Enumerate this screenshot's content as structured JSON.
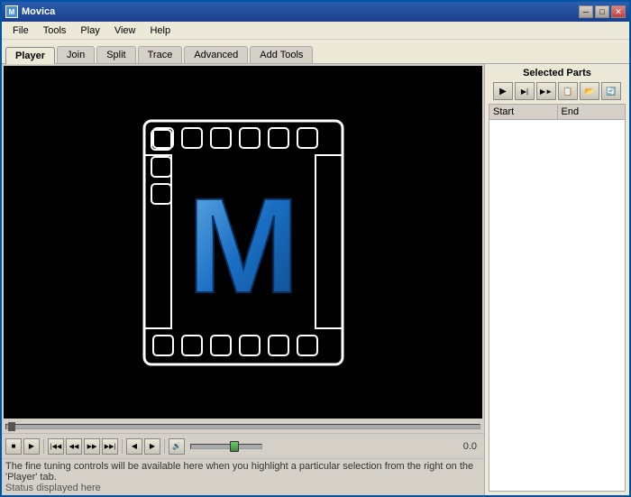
{
  "window": {
    "title": "Movica",
    "icon_label": "M"
  },
  "titlebar_buttons": {
    "minimize": "─",
    "maximize": "□",
    "close": "✕"
  },
  "menubar": {
    "items": [
      "File",
      "Tools",
      "Play",
      "View",
      "Help"
    ]
  },
  "tabs": {
    "items": [
      "Player",
      "Join",
      "Split",
      "Trace",
      "Advanced",
      "Add Tools"
    ],
    "active": "Player"
  },
  "right_panel": {
    "title": "Selected Parts",
    "toolbar_buttons": [
      "▶",
      "▶|",
      "▶►",
      "📋",
      "📂",
      "🔄"
    ],
    "columns": [
      "Start",
      "End"
    ]
  },
  "controls": {
    "buttons": [
      "■",
      "▶",
      "|◀◀",
      "◀◀",
      "▶▶",
      "▶▶|",
      "◀",
      "▶"
    ],
    "time": "0.0"
  },
  "status": {
    "line1": "The fine tuning controls will be available here when you highlight a particular selection from the right on the 'Player' tab.",
    "line2": "Status displayed here"
  }
}
